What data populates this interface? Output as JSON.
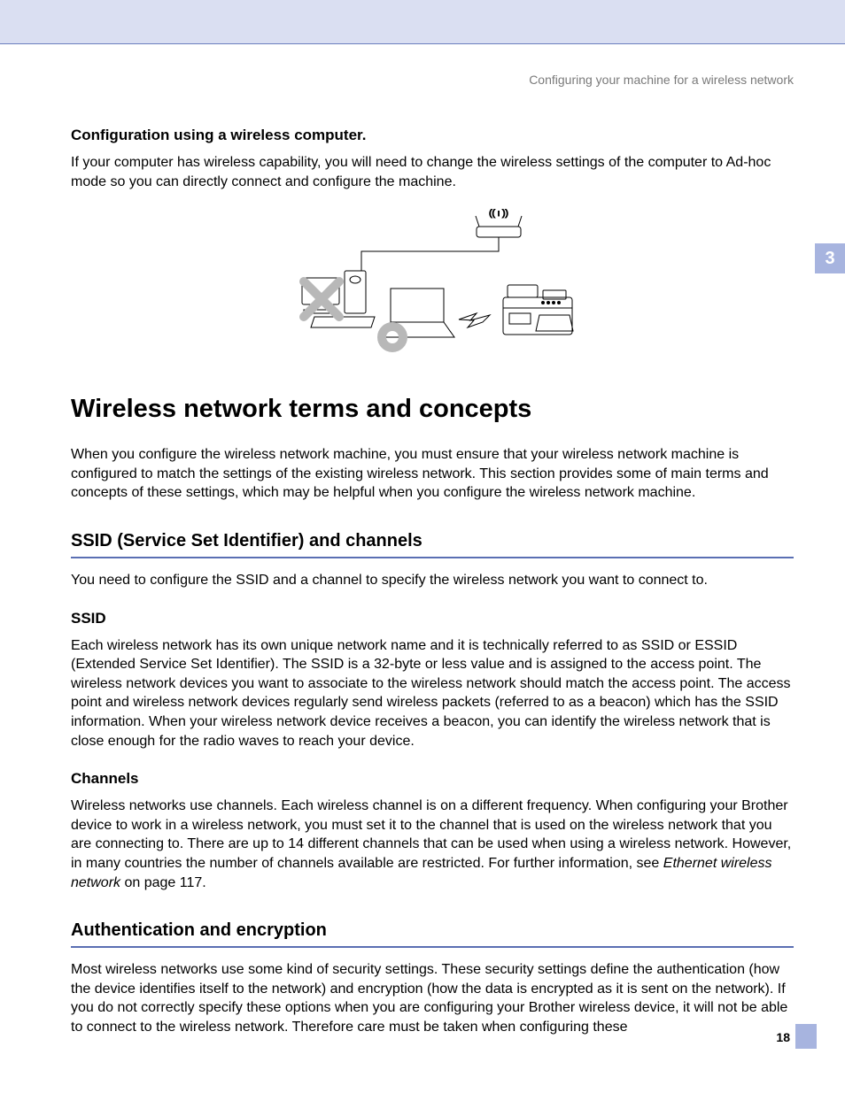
{
  "header": {
    "running_title": "Configuring your machine for a wireless network"
  },
  "chapter_tab": "3",
  "section1": {
    "title": "Configuration using a wireless computer.",
    "body": "If your computer has wireless capability, you will need to change the wireless settings of the computer to Ad-hoc mode so you can directly connect and configure the machine."
  },
  "h1": "Wireless network terms and concepts",
  "intro": "When you configure the wireless network machine, you must ensure that your wireless network machine is configured to match the settings of the existing wireless network. This section provides some of main terms and concepts of these settings, which may be helpful when you configure the wireless network machine.",
  "ssid_section": {
    "title": "SSID (Service Set Identifier) and channels",
    "lead": "You need to configure the SSID and a channel to specify the wireless network you want to connect to.",
    "ssid_title": "SSID",
    "ssid_body": "Each wireless network has its own unique network name and it is technically referred to as SSID or ESSID (Extended Service Set Identifier). The SSID is a 32-byte or less value and is assigned to the access point. The wireless network devices you want to associate to the wireless network should match the access point. The access point and wireless network devices regularly send wireless packets (referred to as a beacon) which has the SSID information. When your wireless network device receives a beacon, you can identify the wireless network that is close enough for the radio waves to reach your device.",
    "channels_title": "Channels",
    "channels_body_pre": "Wireless networks use channels. Each wireless channel is on a different frequency. When configuring your Brother device to work in a wireless network, you must set it to the channel that is used on the wireless network that you are connecting to. There are up to 14 different channels that can be used when using a wireless network. However, in many countries the number of channels available are restricted. For further information, see ",
    "channels_crossref": "Ethernet wireless network",
    "channels_body_post": " on page 117."
  },
  "auth_section": {
    "title": "Authentication and encryption",
    "body": "Most wireless networks use some kind of security settings. These security settings define the authentication (how the device identifies itself to the network) and encryption (how the data is encrypted as it is sent on the network). If you do not correctly specify these options when you are configuring your Brother wireless device, it will not be able to connect to the wireless network. Therefore care must be taken when configuring these"
  },
  "page_number": "18"
}
